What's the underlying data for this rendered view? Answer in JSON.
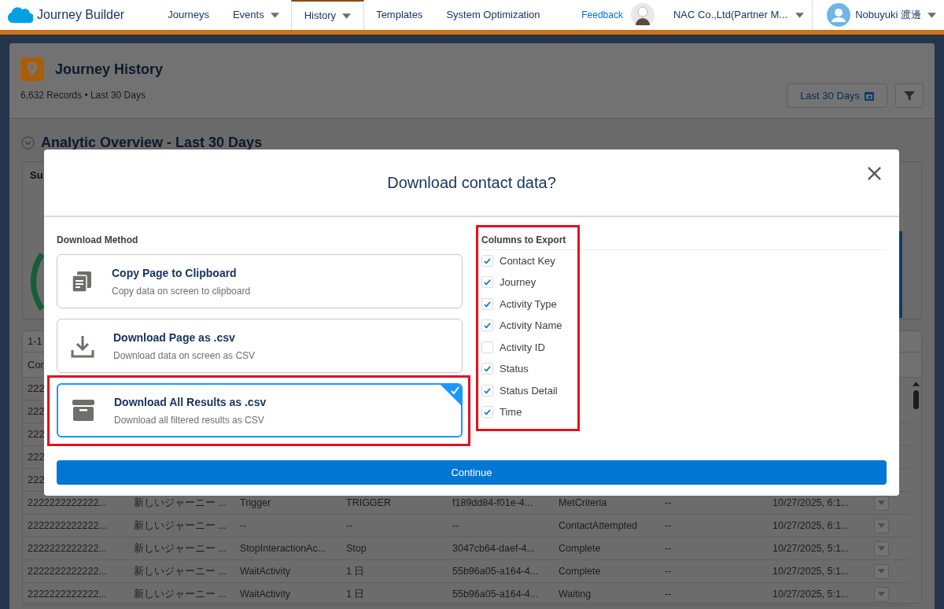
{
  "nav": {
    "app_name": "Journey Builder",
    "tabs": [
      {
        "label": "Journeys",
        "dropdown": false,
        "selected": false
      },
      {
        "label": "Events",
        "dropdown": true,
        "selected": false
      },
      {
        "label": "History",
        "dropdown": true,
        "selected": true
      },
      {
        "label": "Templates",
        "dropdown": false,
        "selected": false
      },
      {
        "label": "System Optimization",
        "dropdown": false,
        "selected": false
      }
    ],
    "feedback": "Feedback",
    "org": "NAC Co.,Ltd(Partner M...",
    "user": "Nobuyuki 渡邊"
  },
  "page": {
    "title": "Journey History",
    "subtitle": "6,632 Records • Last 30 Days",
    "date_range_button": "Last 30 Days",
    "section_title": "Analytic Overview - Last 30 Days",
    "summary_label": "Su"
  },
  "table": {
    "range_label": "1-1",
    "header_label": "Con",
    "hidden_rows": [
      "222",
      "222",
      "222",
      "222",
      "222"
    ],
    "rows": [
      {
        "cells": [
          "2222222222222...",
          "新しいジャーニー ...",
          "Trigger",
          "TRIGGER",
          "f189dd84-f01e-4...",
          "MetCriteria",
          "--",
          "10/27/2025, 6:1..."
        ]
      },
      {
        "cells": [
          "2222222222222...",
          "新しいジャーニー ...",
          "--",
          "--",
          "--",
          "ContactAttempted",
          "--",
          "10/27/2025, 6:1..."
        ]
      },
      {
        "cells": [
          "2222222222222...",
          "新しいジャーニー ...",
          "StopInteractionAc...",
          "Stop",
          "3047cb64-daef-4...",
          "Complete",
          "--",
          "10/27/2025, 5:1..."
        ]
      },
      {
        "cells": [
          "2222222222222...",
          "新しいジャーニー ...",
          "WaitActivity",
          "1 日",
          "55b96a05-a164-4...",
          "Complete",
          "--",
          "10/27/2025, 5:1..."
        ]
      },
      {
        "cells": [
          "2222222222222...",
          "新しいジャーニー ...",
          "WaitActivity",
          "1 日",
          "55b96a05-a164-4...",
          "Waiting",
          "--",
          "10/27/2025, 5:1..."
        ]
      }
    ]
  },
  "modal": {
    "title": "Download contact data?",
    "download_method": {
      "heading": "Download Method",
      "options": [
        {
          "kind": "copy",
          "title": "Copy Page to Clipboard",
          "description": "Copy data on screen to clipboard",
          "selected": false,
          "highlighted": false
        },
        {
          "kind": "download",
          "title": "Download Page as .csv",
          "description": "Download data on screen as CSV",
          "selected": false,
          "highlighted": false
        },
        {
          "kind": "archive",
          "title": "Download All Results as .csv",
          "description": "Download all filtered results as CSV",
          "selected": true,
          "highlighted": true
        }
      ]
    },
    "columns_to_export": {
      "heading": "Columns to Export",
      "highlighted": true,
      "columns": [
        {
          "label": "Contact Key",
          "checked": true
        },
        {
          "label": "Journey",
          "checked": true
        },
        {
          "label": "Activity Type",
          "checked": true
        },
        {
          "label": "Activity Name",
          "checked": true
        },
        {
          "label": "Activity ID",
          "checked": false
        },
        {
          "label": "Status",
          "checked": true
        },
        {
          "label": "Status Detail",
          "checked": true
        },
        {
          "label": "Time",
          "checked": true
        }
      ]
    },
    "continue_button": "Continue"
  }
}
